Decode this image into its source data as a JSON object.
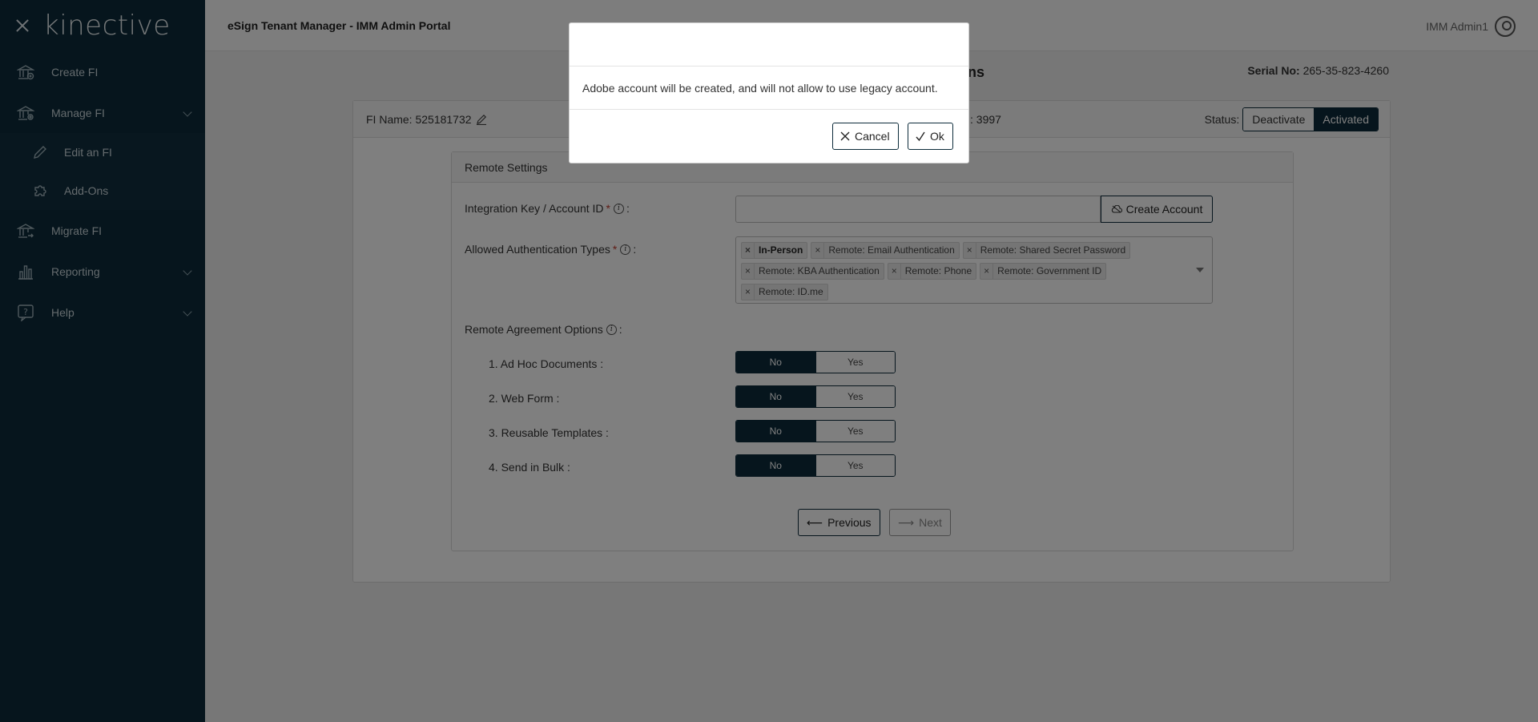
{
  "sidebar": {
    "logo": "kinective",
    "items": [
      {
        "label": "Create FI"
      },
      {
        "label": "Manage FI"
      },
      {
        "label": "Edit an FI"
      },
      {
        "label": "Add-Ons"
      },
      {
        "label": "Migrate FI"
      },
      {
        "label": "Reporting"
      },
      {
        "label": "Help"
      }
    ]
  },
  "topbar": {
    "title": "eSign Tenant Manager - IMM Admin Portal",
    "user": "IMM Admin1"
  },
  "page": {
    "heading_visible": "ns",
    "serial_label": "Serial No:",
    "serial_value": "265-35-823-4260"
  },
  "card": {
    "fi_name": "FI Name: 525181732",
    "fi_id_partial": ": 3997",
    "status_label": "Status:",
    "deactivate": "Deactivate",
    "activated": "Activated"
  },
  "remote": {
    "title": "Remote Settings",
    "integration_label": "Integration Key / Account ID",
    "integration_value": "",
    "create_account": "Create Account",
    "auth_label": "Allowed Authentication Types",
    "auth_tags": [
      "In-Person",
      "Remote: Email Authentication",
      "Remote: Shared Secret Password",
      "Remote: KBA Authentication",
      "Remote: Phone",
      "Remote: Government ID",
      "Remote: ID.me"
    ],
    "agreement_label": "Remote Agreement Options",
    "options": [
      {
        "label": "1. Ad Hoc Documents :",
        "no": "No",
        "yes": "Yes"
      },
      {
        "label": "2. Web Form :",
        "no": "No",
        "yes": "Yes"
      },
      {
        "label": "3. Reusable Templates :",
        "no": "No",
        "yes": "Yes"
      },
      {
        "label": "4. Send in Bulk :",
        "no": "No",
        "yes": "Yes"
      }
    ],
    "previous": "Previous",
    "next": "Next"
  },
  "modal": {
    "message": "Adobe account will be created, and will not allow to use legacy account.",
    "cancel": "Cancel",
    "ok": "Ok"
  },
  "colors": {
    "sidebar_bg": "#0c2b3a",
    "accent": "#0c2b3a",
    "required": "#c0392b"
  }
}
